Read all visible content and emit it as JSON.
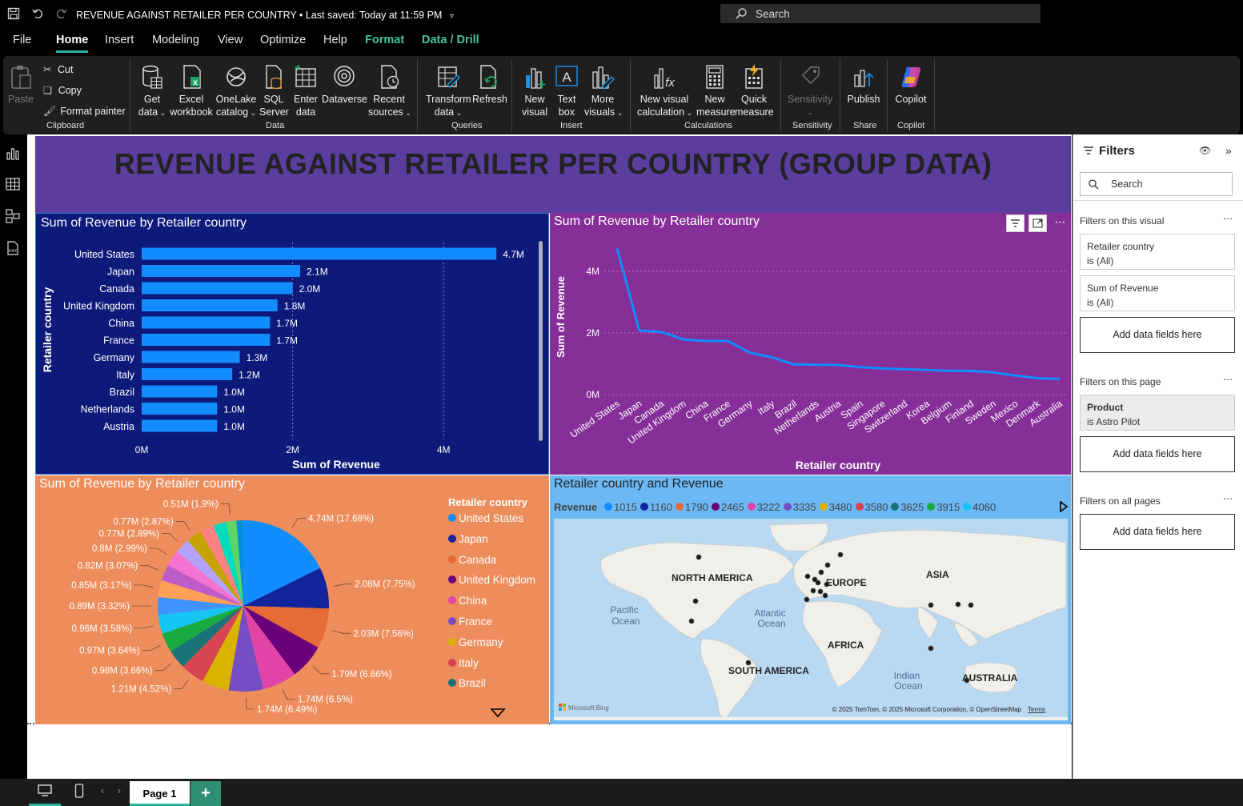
{
  "window": {
    "title": "REVENUE AGAINST RETAILER PER COUNTRY",
    "saved_status": "Last saved: Today at 11:59 PM",
    "search_placeholder": "Search"
  },
  "menu": {
    "items": [
      "File",
      "Home",
      "Insert",
      "Modeling",
      "View",
      "Optimize",
      "Help",
      "Format",
      "Data / Drill"
    ],
    "active": "Home"
  },
  "ribbon": {
    "clipboard": {
      "paste": "Paste",
      "cut": "Cut",
      "copy": "Copy",
      "format_painter": "Format painter",
      "group": "Clipboard"
    },
    "data": {
      "get_data": [
        "Get",
        "data"
      ],
      "excel": [
        "Excel",
        "workbook"
      ],
      "onelake": [
        "OneLake",
        "catalog"
      ],
      "sql": [
        "SQL",
        "Server"
      ],
      "enter": [
        "Enter",
        "data"
      ],
      "dataverse": [
        "Dataverse"
      ],
      "recent": [
        "Recent",
        "sources"
      ],
      "group": "Data"
    },
    "queries": {
      "transform": [
        "Transform",
        "data"
      ],
      "refresh": [
        "Refresh"
      ],
      "group": "Queries"
    },
    "insert": {
      "new_visual": [
        "New",
        "visual"
      ],
      "text_box": [
        "Text",
        "box"
      ],
      "more_visuals": [
        "More",
        "visuals"
      ],
      "group": "Insert"
    },
    "calculations": {
      "new_visual_calc": [
        "New visual",
        "calculation"
      ],
      "new_measure": [
        "New",
        "measure"
      ],
      "quick_measure": [
        "Quick",
        "measure"
      ],
      "group": "Calculations"
    },
    "sensitivity": {
      "label": [
        "Sensitivity"
      ],
      "group": "Sensitivity"
    },
    "share": {
      "publish": [
        "Publish"
      ],
      "group": "Share"
    },
    "copilot": {
      "label": [
        "Copilot"
      ],
      "group": "Copilot"
    }
  },
  "report": {
    "title": "REVENUE AGAINST RETAILER PER COUNTRY (GROUP DATA)"
  },
  "bar_panel": {
    "title": "Sum of Revenue by Retailer country",
    "x_ticks": [
      "0M",
      "2M",
      "4M"
    ]
  },
  "line_panel": {
    "title": "Sum of Revenue by Retailer country",
    "y_ticks": [
      "0M",
      "2M",
      "4M"
    ]
  },
  "pie_panel": {
    "title": "Sum of Revenue by Retailer country",
    "legend_title": "Retailer country"
  },
  "map_panel": {
    "title": "Retailer country and Revenue",
    "legend_label": "Revenue",
    "legend_items": [
      {
        "label": "1015",
        "color": "#118DFF"
      },
      {
        "label": "1160",
        "color": "#12239E"
      },
      {
        "label": "1790",
        "color": "#E66C37"
      },
      {
        "label": "2465",
        "color": "#6B007B"
      },
      {
        "label": "3222",
        "color": "#E044A7"
      },
      {
        "label": "3335",
        "color": "#744EC2"
      },
      {
        "label": "3480",
        "color": "#D9B300"
      },
      {
        "label": "3580",
        "color": "#D64550"
      },
      {
        "label": "3625",
        "color": "#197278"
      },
      {
        "label": "3915",
        "color": "#1AAB40"
      },
      {
        "label": "4060",
        "color": "#15C6F4"
      }
    ],
    "regions": [
      "NORTH AMERICA",
      "EUROPE",
      "ASIA",
      "AFRICA",
      "SOUTH AMERICA",
      "AUSTRALIA"
    ],
    "oceans": [
      [
        "Pacific",
        "Ocean"
      ],
      [
        "Atlantic",
        "Ocean"
      ],
      [
        "Indian",
        "Ocean"
      ]
    ],
    "attribution": "© 2025 TomTom, © 2025 Microsoft Corporation, © OpenStreetMap",
    "terms": "Terms",
    "bing": "Microsoft Bing"
  },
  "filters": {
    "title": "Filters",
    "search_placeholder": "Search",
    "on_visual": "Filters on this visual",
    "visual_cards": [
      {
        "field": "Retailer country",
        "state": "is (All)"
      },
      {
        "field": "Sum of Revenue",
        "state": "is (All)"
      }
    ],
    "on_page": "Filters on this page",
    "page_card": {
      "field": "Product",
      "state": "is Astro Pilot"
    },
    "on_all": "Filters on all pages",
    "add_fields": "Add data fields here"
  },
  "bottom": {
    "page_tab": "Page 1",
    "add_tab": "+"
  },
  "chart_data": [
    {
      "type": "bar",
      "title": "Sum of Revenue by Retailer country",
      "xlabel": "Sum of Revenue",
      "ylabel": "Retailer country",
      "xlim": [
        0,
        5
      ],
      "x_unit": "M",
      "categories": [
        "United States",
        "Japan",
        "Canada",
        "United Kingdom",
        "China",
        "France",
        "Germany",
        "Italy",
        "Brazil",
        "Netherlands",
        "Austria"
      ],
      "values": [
        4.7,
        2.1,
        2.0,
        1.8,
        1.7,
        1.7,
        1.3,
        1.2,
        1.0,
        1.0,
        1.0
      ],
      "labels": [
        "4.7M",
        "2.1M",
        "2.0M",
        "1.8M",
        "1.7M",
        "1.7M",
        "1.3M",
        "1.2M",
        "1.0M",
        "1.0M",
        "1.0M"
      ],
      "color": "#118DFF"
    },
    {
      "type": "line",
      "title": "Sum of Revenue by Retailer country",
      "xlabel": "Retailer country",
      "ylabel": "Sum of Revenue",
      "ylim": [
        0,
        5
      ],
      "y_unit": "M",
      "categories": [
        "United States",
        "Japan",
        "Canada",
        "United Kingdom",
        "China",
        "France",
        "Germany",
        "Italy",
        "Brazil",
        "Netherlands",
        "Austria",
        "Spain",
        "Singapore",
        "Switzerland",
        "Korea",
        "Belgium",
        "Finland",
        "Sweden",
        "Mexico",
        "Denmark",
        "Australia"
      ],
      "values": [
        4.74,
        2.08,
        2.03,
        1.79,
        1.74,
        1.74,
        1.36,
        1.21,
        0.98,
        0.97,
        0.96,
        0.89,
        0.85,
        0.82,
        0.8,
        0.77,
        0.77,
        0.72,
        0.62,
        0.53,
        0.51
      ],
      "color": "#118DFF"
    },
    {
      "type": "pie",
      "title": "Sum of Revenue by Retailer country",
      "legend": [
        "United States",
        "Japan",
        "Canada",
        "United Kingdom",
        "China",
        "France",
        "Germany",
        "Italy",
        "Brazil"
      ],
      "slices": [
        {
          "label": "4.74M (17.68%)",
          "value": 17.68,
          "color": "#118DFF"
        },
        {
          "label": "2.08M (7.75%)",
          "value": 7.75,
          "color": "#12239E"
        },
        {
          "label": "2.03M (7.56%)",
          "value": 7.56,
          "color": "#E66C37"
        },
        {
          "label": "1.79M (6.66%)",
          "value": 6.66,
          "color": "#6B007B"
        },
        {
          "label": "1.74M (6.5%)",
          "value": 6.5,
          "color": "#E044A7"
        },
        {
          "label": "1.74M (6.49%)",
          "value": 6.49,
          "color": "#744EC2"
        },
        {
          "label": "",
          "value": 5.1,
          "color": "#D9B300"
        },
        {
          "label": "1.21M (4.52%)",
          "value": 4.52,
          "color": "#D64550"
        },
        {
          "label": "0.98M (3.66%)",
          "value": 3.66,
          "color": "#197278"
        },
        {
          "label": "0.97M (3.64%)",
          "value": 3.64,
          "color": "#1AAB40"
        },
        {
          "label": "0.96M (3.58%)",
          "value": 3.58,
          "color": "#15C6F4"
        },
        {
          "label": "0.89M (3.32%)",
          "value": 3.32,
          "color": "#4092FF"
        },
        {
          "label": "0.85M (3.17%)",
          "value": 3.17,
          "color": "#FFA058"
        },
        {
          "label": "0.82M (3.07%)",
          "value": 3.07,
          "color": "#BE5DC9"
        },
        {
          "label": "0.8M (2.99%)",
          "value": 2.99,
          "color": "#F472D0"
        },
        {
          "label": "0.77M (2.89%)",
          "value": 2.89,
          "color": "#B5A1FF"
        },
        {
          "label": "0.77M (2.87%)",
          "value": 2.87,
          "color": "#C4A200"
        },
        {
          "label": "",
          "value": 2.7,
          "color": "#FF8080"
        },
        {
          "label": "",
          "value": 2.4,
          "color": "#00DBBC"
        },
        {
          "label": "0.51M (1.9%)",
          "value": 1.9,
          "color": "#5BD667"
        },
        {
          "label": "",
          "value": 1.3,
          "color": "#0091D5"
        }
      ]
    }
  ]
}
